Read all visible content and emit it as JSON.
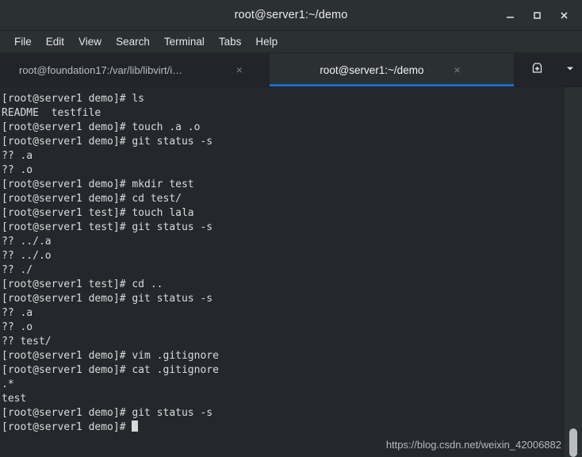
{
  "window": {
    "title": "root@server1:~/demo",
    "controls": [
      {
        "name": "minimize",
        "glyph": "minimize-icon"
      },
      {
        "name": "maximize",
        "glyph": "maximize-icon"
      },
      {
        "name": "close",
        "glyph": "close-icon"
      }
    ]
  },
  "menubar": {
    "items": [
      {
        "label": "File"
      },
      {
        "label": "Edit"
      },
      {
        "label": "View"
      },
      {
        "label": "Search"
      },
      {
        "label": "Terminal"
      },
      {
        "label": "Tabs"
      },
      {
        "label": "Help"
      }
    ]
  },
  "tabbar": {
    "tabs": [
      {
        "label": "root@foundation17:/var/lib/libvirt/i…",
        "active": false,
        "close_label": "×"
      },
      {
        "label": "root@server1:~/demo",
        "active": true,
        "close_label": "×"
      }
    ],
    "new_tab_icon": "new-tab-icon",
    "tab_menu_icon": "chevron-down-icon",
    "active_accent_color": "#1b6ac9"
  },
  "terminal": {
    "background_color": "#24282c",
    "foreground_color": "#d9dcdd",
    "lines": [
      "[root@server1 demo]# ls",
      "README  testfile",
      "[root@server1 demo]# touch .a .o",
      "[root@server1 demo]# git status -s",
      "?? .a",
      "?? .o",
      "[root@server1 demo]# mkdir test",
      "[root@server1 demo]# cd test/",
      "[root@server1 test]# touch lala",
      "[root@server1 test]# git status -s",
      "?? ../.a",
      "?? ../.o",
      "?? ./",
      "[root@server1 test]# cd ..",
      "[root@server1 demo]# git status -s",
      "?? .a",
      "?? .o",
      "?? test/",
      "[root@server1 demo]# vim .gitignore",
      "[root@server1 demo]# cat .gitignore",
      ".*",
      "test",
      "[root@server1 demo]# git status -s"
    ],
    "prompt_line": "[root@server1 demo]# ",
    "cursor": "block-cursor"
  },
  "watermark": {
    "text": "https://blog.csdn.net/weixin_42006882"
  },
  "scrollbar": {
    "name": "vertical-scrollbar"
  }
}
